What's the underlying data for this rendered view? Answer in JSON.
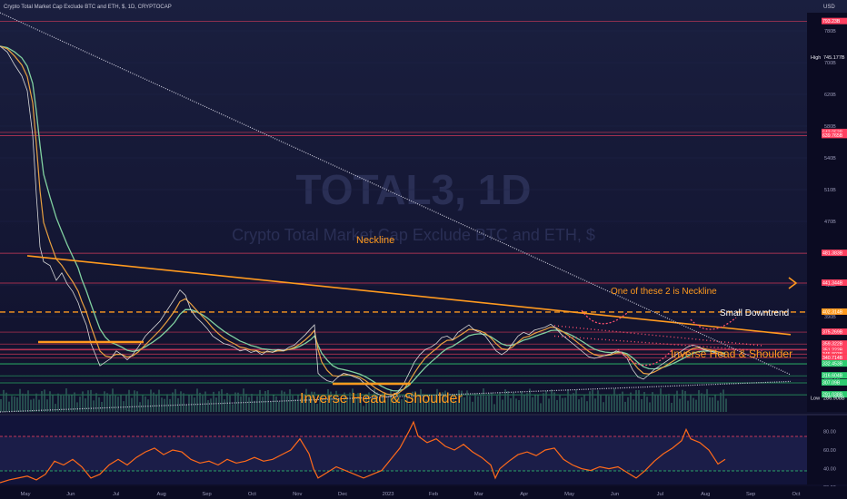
{
  "header": {
    "symbol_title": "Crypto Total Market Cap Exclude BTC and ETH, $, 1D, CRYPTOCAP",
    "currency": "USD"
  },
  "watermark": {
    "ticker": "TOTAL3, 1D",
    "description": "Crypto Total Market Cap Exclude BTC and ETH, $"
  },
  "colors": {
    "background": "#0e0e2a",
    "price_line": "#d8d8d8",
    "ema_fast": "#e8a040",
    "ema_slow": "#80d0a0",
    "annotation": "#ff9a1f",
    "level_red": "#ff4060",
    "level_green": "#2ecc71",
    "rsi_line": "#ff6a1a",
    "volume": "#2a5a56"
  },
  "annotations": {
    "neckline": "Neckline",
    "one_of_these": "One of these 2 is Neckline",
    "small_downtrend": "Small Downtrend",
    "ihs_right": "Inverse Head & Shoulder",
    "ihs_left": "Inverse Head & Shoulder"
  },
  "chart_data": [
    {
      "type": "line",
      "ylabel": "",
      "ylim": [
        268,
        805
      ],
      "x_ticks": [
        "May",
        "Jun",
        "Jul",
        "Aug",
        "Sep",
        "Oct",
        "Nov",
        "Dec",
        "2023",
        "Feb",
        "Mar",
        "Apr",
        "May",
        "Jun",
        "Jul",
        "Aug",
        "Sep",
        "Oct"
      ],
      "y_ticks": [
        "780B",
        "700B",
        "620B",
        "580B",
        "540B",
        "510B",
        "470B",
        "450B",
        "410B",
        "390B",
        "279.5B",
        "268.5B"
      ],
      "price_labels": [
        {
          "label": "793.23B",
          "value": 793.2,
          "kind": "red"
        },
        {
          "label": "745.177B",
          "value": 745.2,
          "kind": "high_text"
        },
        {
          "label": "643.953B",
          "value": 644.0,
          "kind": "red"
        },
        {
          "label": "639.765B",
          "value": 639.8,
          "kind": "red"
        },
        {
          "label": "481.383B",
          "value": 481.4,
          "kind": "red"
        },
        {
          "label": "441.344B",
          "value": 441.3,
          "kind": "red"
        },
        {
          "label": "402.314B",
          "value": 402.3,
          "kind": "orange"
        },
        {
          "label": "375.269B",
          "value": 375.3,
          "kind": "red"
        },
        {
          "label": "359.322B",
          "value": 359.3,
          "kind": "red"
        },
        {
          "label": "352.193B",
          "value": 352.2,
          "kind": "red"
        },
        {
          "label": "351.222B",
          "value": 351.2,
          "kind": "red"
        },
        {
          "label": "345.803B",
          "value": 345.8,
          "kind": "red"
        },
        {
          "label": "341.368B",
          "value": 341.4,
          "kind": "current"
        },
        {
          "label": "340.714B",
          "value": 340.7,
          "kind": "red"
        },
        {
          "label": "332.717B",
          "value": 332.7,
          "kind": "green"
        },
        {
          "label": "332.453B",
          "value": 332.5,
          "kind": "green"
        },
        {
          "label": "316.604B",
          "value": 316.6,
          "kind": "green"
        },
        {
          "label": "307.09B",
          "value": 307.1,
          "kind": "green"
        },
        {
          "label": "291.038B",
          "value": 291.0,
          "kind": "green"
        },
        {
          "label": "286.908B",
          "value": 286.9,
          "kind": "low_text"
        }
      ],
      "high_label": "High",
      "low_label": "Low",
      "series": [
        {
          "values": [
            [
              0,
              760
            ],
            [
              8,
              752
            ],
            [
              16,
              735
            ],
            [
              24,
              720
            ],
            [
              30,
              700
            ],
            [
              36,
              640
            ],
            [
              40,
              560
            ],
            [
              44,
              490
            ],
            [
              48,
              470
            ],
            [
              55,
              465
            ],
            [
              62,
              445
            ],
            [
              68,
              455
            ],
            [
              74,
              440
            ],
            [
              80,
              430
            ],
            [
              86,
              415
            ],
            [
              90,
              400
            ],
            [
              95,
              385
            ],
            [
              100,
              360
            ],
            [
              105,
              345
            ],
            [
              110,
              330
            ],
            [
              116,
              335
            ],
            [
              122,
              340
            ],
            [
              128,
              350
            ],
            [
              134,
              345
            ],
            [
              140,
              338
            ],
            [
              146,
              345
            ],
            [
              152,
              355
            ],
            [
              160,
              370
            ],
            [
              168,
              380
            ],
            [
              176,
              390
            ],
            [
              184,
              405
            ],
            [
              192,
              420
            ],
            [
              198,
              432
            ],
            [
              204,
              425
            ],
            [
              210,
              405
            ],
            [
              216,
              395
            ],
            [
              222,
              388
            ],
            [
              228,
              380
            ],
            [
              234,
              370
            ],
            [
              240,
              365
            ],
            [
              246,
              360
            ],
            [
              252,
              358
            ],
            [
              258,
              355
            ],
            [
              264,
              350
            ],
            [
              270,
              352
            ],
            [
              276,
              348
            ],
            [
              282,
              350
            ],
            [
              288,
              345
            ],
            [
              294,
              350
            ],
            [
              300,
              348
            ],
            [
              306,
              352
            ],
            [
              312,
              350
            ],
            [
              318,
              355
            ],
            [
              324,
              358
            ],
            [
              330,
              365
            ],
            [
              336,
              372
            ],
            [
              342,
              380
            ],
            [
              346,
              385
            ],
            [
              350,
              320
            ],
            [
              354,
              315
            ],
            [
              360,
              310
            ],
            [
              366,
              308
            ],
            [
              372,
              315
            ],
            [
              378,
              320
            ],
            [
              384,
              318
            ],
            [
              390,
              315
            ],
            [
              396,
              312
            ],
            [
              402,
              305
            ],
            [
              408,
              298
            ],
            [
              414,
              293
            ],
            [
              420,
              290
            ],
            [
              426,
              288
            ],
            [
              432,
              290
            ],
            [
              438,
              295
            ],
            [
              444,
              305
            ],
            [
              450,
              320
            ],
            [
              456,
              335
            ],
            [
              462,
              345
            ],
            [
              468,
              352
            ],
            [
              474,
              355
            ],
            [
              480,
              360
            ],
            [
              486,
              368
            ],
            [
              492,
              370
            ],
            [
              498,
              365
            ],
            [
              504,
              375
            ],
            [
              510,
              380
            ],
            [
              516,
              385
            ],
            [
              522,
              378
            ],
            [
              528,
              375
            ],
            [
              534,
              370
            ],
            [
              540,
              360
            ],
            [
              546,
              350
            ],
            [
              552,
              345
            ],
            [
              558,
              350
            ],
            [
              564,
              360
            ],
            [
              570,
              370
            ],
            [
              576,
              375
            ],
            [
              582,
              372
            ],
            [
              588,
              378
            ],
            [
              594,
              380
            ],
            [
              600,
              382
            ],
            [
              606,
              386
            ],
            [
              612,
              380
            ],
            [
              618,
              372
            ],
            [
              624,
              366
            ],
            [
              630,
              360
            ],
            [
              636,
              354
            ],
            [
              642,
              348
            ],
            [
              648,
              342
            ],
            [
              654,
              340
            ],
            [
              660,
              342
            ],
            [
              666,
              344
            ],
            [
              672,
              346
            ],
            [
              678,
              350
            ],
            [
              684,
              348
            ],
            [
              690,
              340
            ],
            [
              696,
              325
            ],
            [
              702,
              315
            ],
            [
              708,
              312
            ],
            [
              714,
              318
            ],
            [
              720,
              325
            ],
            [
              726,
              330
            ],
            [
              732,
              335
            ],
            [
              738,
              340
            ],
            [
              744,
              345
            ],
            [
              750,
              350
            ],
            [
              756,
              355
            ],
            [
              762,
              358
            ],
            [
              768,
              356
            ],
            [
              774,
              352
            ],
            [
              780,
              350
            ],
            [
              786,
              348
            ],
            [
              792,
              345
            ],
            [
              798,
              342
            ]
          ]
        }
      ]
    },
    {
      "type": "line",
      "ylabel": "",
      "ylim": [
        25,
        95
      ],
      "y_ticks": [
        "80.00",
        "60.00",
        "40.00",
        "20.00"
      ],
      "series": [
        {
          "values": [
            [
              0,
              25
            ],
            [
              10,
              28
            ],
            [
              20,
              30
            ],
            [
              30,
              32
            ],
            [
              40,
              28
            ],
            [
              50,
              34
            ],
            [
              60,
              48
            ],
            [
              70,
              44
            ],
            [
              80,
              50
            ],
            [
              90,
              42
            ],
            [
              100,
              30
            ],
            [
              110,
              34
            ],
            [
              120,
              44
            ],
            [
              130,
              50
            ],
            [
              140,
              44
            ],
            [
              150,
              52
            ],
            [
              160,
              58
            ],
            [
              170,
              62
            ],
            [
              180,
              55
            ],
            [
              190,
              60
            ],
            [
              200,
              58
            ],
            [
              210,
              50
            ],
            [
              220,
              46
            ],
            [
              230,
              48
            ],
            [
              240,
              44
            ],
            [
              250,
              50
            ],
            [
              260,
              46
            ],
            [
              270,
              48
            ],
            [
              280,
              52
            ],
            [
              290,
              48
            ],
            [
              300,
              50
            ],
            [
              310,
              55
            ],
            [
              320,
              60
            ],
            [
              330,
              72
            ],
            [
              340,
              56
            ],
            [
              345,
              40
            ],
            [
              350,
              30
            ],
            [
              360,
              36
            ],
            [
              370,
              42
            ],
            [
              380,
              38
            ],
            [
              390,
              34
            ],
            [
              400,
              30
            ],
            [
              410,
              34
            ],
            [
              420,
              38
            ],
            [
              430,
              50
            ],
            [
              440,
              62
            ],
            [
              450,
              80
            ],
            [
              455,
              90
            ],
            [
              460,
              75
            ],
            [
              470,
              68
            ],
            [
              480,
              72
            ],
            [
              490,
              64
            ],
            [
              500,
              60
            ],
            [
              510,
              66
            ],
            [
              520,
              58
            ],
            [
              530,
              52
            ],
            [
              540,
              44
            ],
            [
              545,
              30
            ],
            [
              550,
              40
            ],
            [
              560,
              48
            ],
            [
              570,
              55
            ],
            [
              580,
              58
            ],
            [
              590,
              54
            ],
            [
              600,
              60
            ],
            [
              610,
              62
            ],
            [
              620,
              50
            ],
            [
              630,
              44
            ],
            [
              640,
              40
            ],
            [
              650,
              38
            ],
            [
              660,
              42
            ],
            [
              670,
              40
            ],
            [
              680,
              42
            ],
            [
              690,
              36
            ],
            [
              700,
              30
            ],
            [
              710,
              38
            ],
            [
              720,
              48
            ],
            [
              730,
              56
            ],
            [
              740,
              62
            ],
            [
              750,
              70
            ],
            [
              755,
              82
            ],
            [
              760,
              72
            ],
            [
              770,
              68
            ],
            [
              780,
              60
            ],
            [
              790,
              45
            ],
            [
              798,
              50
            ]
          ]
        }
      ]
    }
  ]
}
